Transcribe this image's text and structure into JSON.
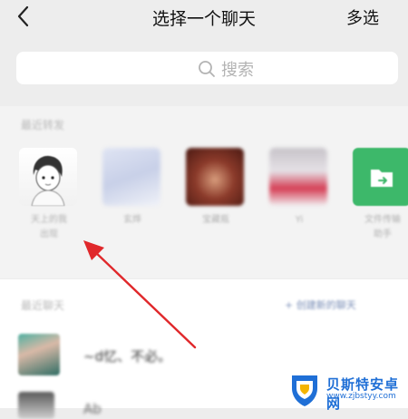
{
  "header": {
    "title": "选择一个聊天",
    "multi_select": "多选"
  },
  "search": {
    "placeholder": "搜索"
  },
  "recent_contacts": {
    "label": "最近转发",
    "items": [
      {
        "name": "天上的我\n出现",
        "avatar": "cartoon-boy"
      },
      {
        "name": "玄烨",
        "avatar": "blurred-photo"
      },
      {
        "name": "宝藏瓶",
        "avatar": "blurred-photo"
      },
      {
        "name": "Yi",
        "avatar": "blurred-photo"
      },
      {
        "name": "文件传输\n助手",
        "avatar": "folder-icon"
      }
    ]
  },
  "recent_chats": {
    "label": "最近聊天",
    "create_link": "+ 创建新的聊天",
    "rows": [
      {
        "name": "~d忆、不必。"
      },
      {
        "name": "Ab"
      }
    ]
  },
  "watermark": {
    "title": "贝斯特安卓网",
    "url": "www.zjbstyy.com"
  },
  "colors": {
    "background": "#ededed",
    "arrow": "#e0282b",
    "watermark": "#1f6fd6",
    "file_helper_green": "#3db86a"
  }
}
